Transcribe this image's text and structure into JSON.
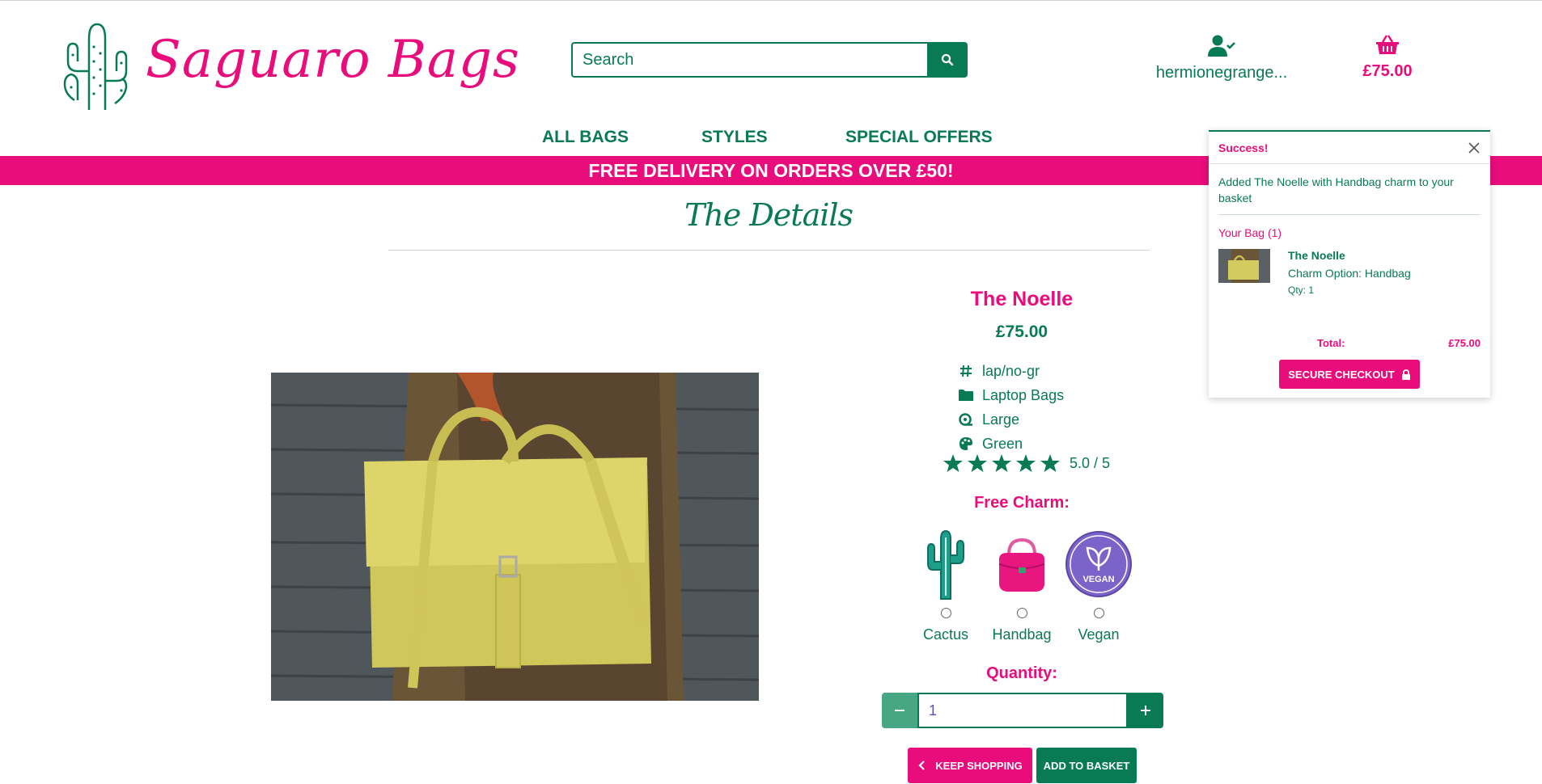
{
  "brand": {
    "name": "Saguaro Bags"
  },
  "search": {
    "placeholder": "Search"
  },
  "account": {
    "username": "hermionegrange..."
  },
  "basket": {
    "total": "£75.00"
  },
  "nav": [
    "ALL BAGS",
    "STYLES",
    "SPECIAL OFFERS"
  ],
  "banner": {
    "text": "FREE DELIVERY ON ORDERS OVER £50!"
  },
  "page": {
    "title": "The Details"
  },
  "product": {
    "name": "The Noelle",
    "price": "£75.00",
    "sku": "lap/no-gr",
    "category": "Laptop Bags",
    "size": "Large",
    "color": "Green",
    "rating_text": "5.0 / 5",
    "rating": 5
  },
  "charm": {
    "label": "Free Charm:",
    "options": [
      "Cactus",
      "Handbag",
      "Vegan"
    ],
    "vegan_badge": "VEGAN"
  },
  "quantity": {
    "label": "Quantity:",
    "value": "1"
  },
  "buttons": {
    "keep_shopping": "KEEP SHOPPING",
    "add_to_basket": "ADD TO BASKET"
  },
  "toast": {
    "title": "Success!",
    "message": "Added The Noelle with Handbag charm to your basket",
    "bag_label": "Your Bag (1)",
    "item_name": "The Noelle",
    "item_option": "Charm Option: Handbag",
    "item_qty": "Qty: 1",
    "total_label": "Total:",
    "total_value": "£75.00",
    "checkout": "SECURE CHECKOUT"
  },
  "colors": {
    "green": "#087a54",
    "pink": "#e90c7b",
    "light_green": "#47a684"
  }
}
